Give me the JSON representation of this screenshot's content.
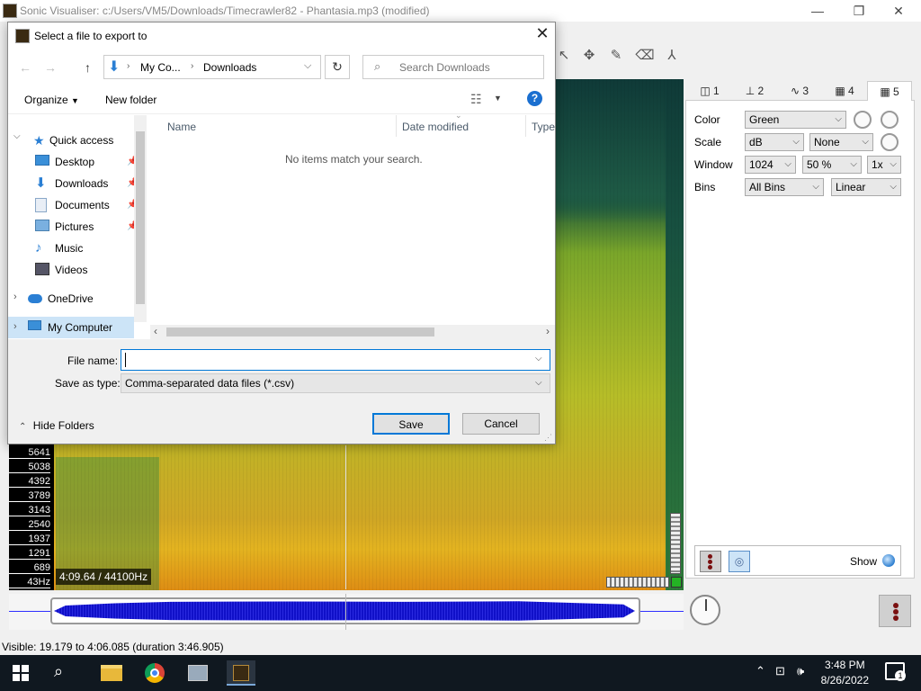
{
  "window": {
    "title": "Sonic Visualiser: c:/Users/VM5/Downloads/Timecrawler82 - Phantasia.mp3 (modified)",
    "minimize": "—",
    "maximize": "❐",
    "close": "✕"
  },
  "toolbar": {
    "icons": [
      "cursor-icon",
      "move-icon",
      "pencil-icon",
      "erase-icon",
      "measure-icon"
    ],
    "glyphs": {
      "cursor": "↖",
      "move": "✥",
      "pencil": "✎",
      "erase": "⌫",
      "measure": "⅄"
    }
  },
  "spectrogram": {
    "time_badge": "4:09.64 / 44100Hz",
    "y_ticks": [
      "5641",
      "5038",
      "4392",
      "3789",
      "3143",
      "2540",
      "1937",
      "1291",
      "689",
      "43Hz"
    ]
  },
  "panel": {
    "tabs": [
      {
        "icon": "pane-icon",
        "glyph": "◫",
        "label": "1"
      },
      {
        "icon": "ruler-icon",
        "glyph": "⊥",
        "label": "2"
      },
      {
        "icon": "waveform-icon",
        "glyph": "∿",
        "label": "3"
      },
      {
        "icon": "spectrogram-icon",
        "glyph": "▦",
        "label": "4"
      },
      {
        "icon": "spectrogram-icon",
        "glyph": "▦",
        "label": "5"
      }
    ],
    "color_label": "Color",
    "color_value": "Green",
    "scale_label": "Scale",
    "scale_value": "dB",
    "scale_norm": "None",
    "window_label": "Window",
    "window_size": "1024",
    "window_overlap": "50 %",
    "window_zoom": "1x",
    "bins_label": "Bins",
    "bins_value": "All Bins",
    "bins_scale": "Linear",
    "show_label": "Show"
  },
  "status": {
    "text": "Visible: 19.179 to 4:06.085 (duration 3:46.905)"
  },
  "taskbar": {
    "time": "3:48 PM",
    "date": "8/26/2022",
    "notification_count": "1",
    "apps": [
      "file-explorer-icon",
      "chrome-icon",
      "network-app-icon",
      "sonic-visualiser-icon"
    ]
  },
  "dialog": {
    "title": "Select a file to export to",
    "close": "✕",
    "breadcrumb": [
      "My Co...",
      "Downloads"
    ],
    "search_placeholder": "Search Downloads",
    "organize": "Organize",
    "new_folder": "New folder",
    "help": "?",
    "columns": [
      "Name",
      "Date modified",
      "Type"
    ],
    "empty_message": "No items match your search.",
    "nav": [
      {
        "label": "Quick access",
        "icon": "star-icon"
      },
      {
        "label": "Desktop",
        "icon": "desktop-folder-icon",
        "pinned": true
      },
      {
        "label": "Downloads",
        "icon": "downloads-folder-icon",
        "pinned": true
      },
      {
        "label": "Documents",
        "icon": "documents-folder-icon",
        "pinned": true
      },
      {
        "label": "Pictures",
        "icon": "pictures-folder-icon",
        "pinned": true
      },
      {
        "label": "Music",
        "icon": "music-folder-icon"
      },
      {
        "label": "Videos",
        "icon": "videos-folder-icon"
      },
      {
        "label": "OneDrive",
        "icon": "onedrive-cloud-icon"
      },
      {
        "label": "My Computer",
        "icon": "computer-icon"
      }
    ],
    "file_name_label": "File name:",
    "file_name_value": "",
    "save_type_label": "Save as type:",
    "save_type_value": "Comma-separated data files (*.csv)",
    "hide_folders": "Hide Folders",
    "save": "Save",
    "cancel": "Cancel"
  },
  "colors": {
    "accent": "#0078d7",
    "taskbar": "#101820",
    "waveform": "#1a1ad8"
  }
}
